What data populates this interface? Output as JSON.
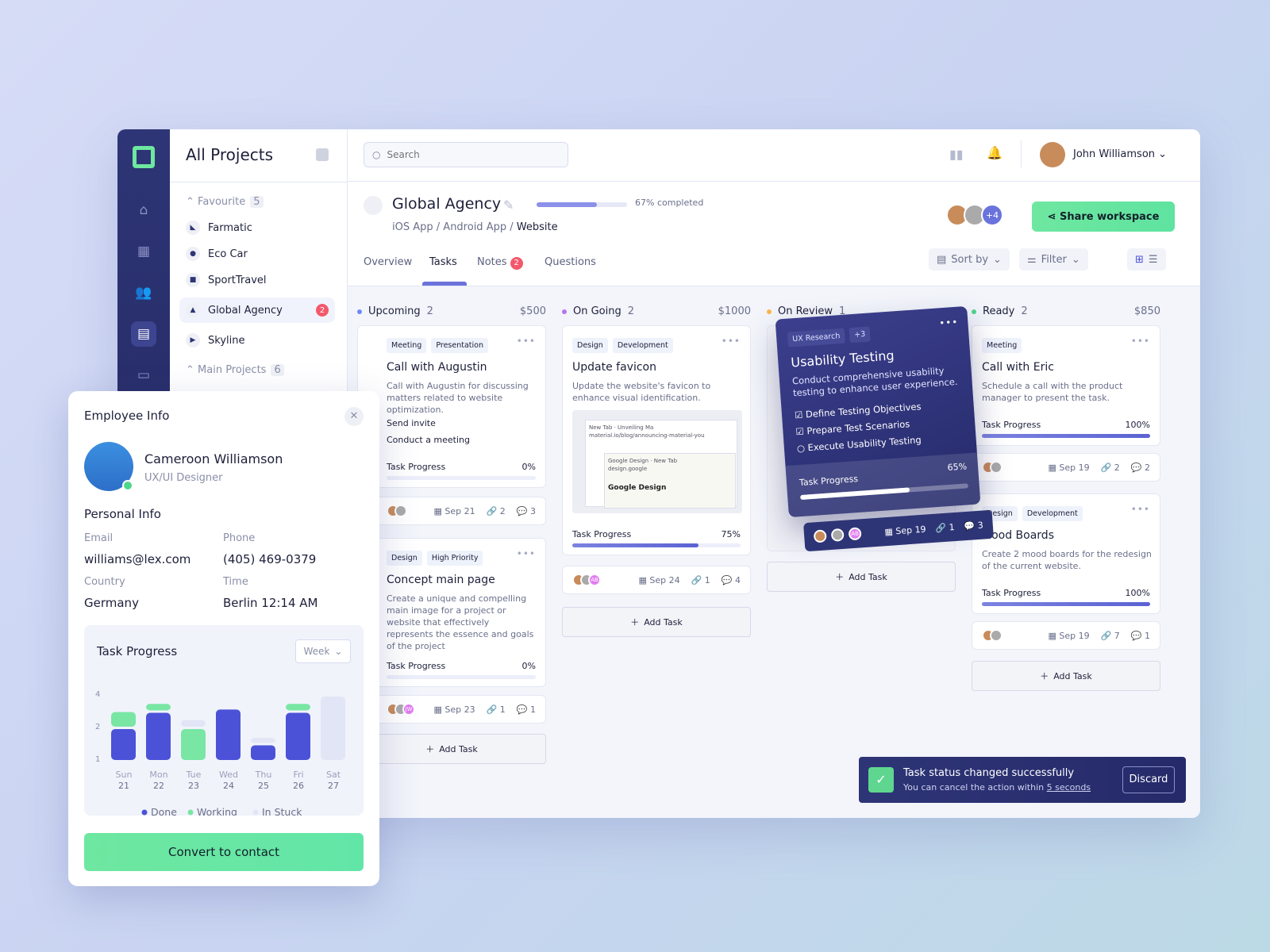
{
  "sidebar": {
    "title": "All Projects",
    "favourite_label": "Favourite",
    "favourite_count": "5",
    "projects": [
      {
        "name": "Farmatic"
      },
      {
        "name": "Eco Car"
      },
      {
        "name": "SportTravel"
      },
      {
        "name": "Global Agency",
        "badge": "2"
      },
      {
        "name": "Skyline"
      }
    ],
    "main_label": "Main Projects",
    "main_count": "6"
  },
  "topbar": {
    "search_placeholder": "Search",
    "user_name": "John Williamson"
  },
  "project": {
    "title": "Global Agency",
    "progress_percent": 67,
    "progress_text": "67% completed",
    "breadcrumb": [
      "iOS App",
      "Android App",
      "Website"
    ],
    "members_extra": "+4",
    "share_label": "Share workspace",
    "tabs": [
      {
        "label": "Overview"
      },
      {
        "label": "Tasks",
        "active": true
      },
      {
        "label": "Notes",
        "badge": "2"
      },
      {
        "label": "Questions"
      }
    ],
    "sort_label": "Sort by",
    "filter_label": "Filter"
  },
  "columns": [
    {
      "name": "Upcoming",
      "count": "2",
      "amount": "$500",
      "color": "#6b8bf5",
      "cards": [
        {
          "tags": [
            "Meeting",
            "Presentation"
          ],
          "title": "Call with Augustin",
          "desc": "Call with Augustin for discussing matters related to website optimization.",
          "checks": [
            "Send invite",
            "Conduct a meeting"
          ],
          "progress_label": "Task Progress",
          "progress": "0%",
          "date": "Sep 21",
          "links": "2",
          "comments": "3"
        },
        {
          "tags": [
            "Design",
            "High Priority"
          ],
          "title": "Concept main page",
          "desc": "Create a unique and compelling main image for a project or website that effectively represents the essence and goals of the project",
          "progress_label": "Task Progress",
          "progress": "0%",
          "date": "Sep 23",
          "links": "1",
          "comments": "1",
          "avatar_text": "JW"
        }
      ],
      "add_label": "Add Task"
    },
    {
      "name": "On Going",
      "count": "2",
      "amount": "$1000",
      "color": "#b476f0",
      "cards": [
        {
          "tags": [
            "Design",
            "Development"
          ],
          "title": "Update favicon",
          "desc": "Update  the website's favicon to enhance visual identification.",
          "preview": {
            "tab1": "New Tab",
            "tab2": "Unveiling Ma",
            "url": "material.io/blog/announcing-material-you",
            "tab3": "Google Design",
            "tab4": "New Tab",
            "url2": "design.google",
            "brand": "Google Design"
          },
          "progress_label": "Task Progress",
          "progress": "75%",
          "date": "Sep 24",
          "links": "1",
          "comments": "4",
          "avatar_text": "AB"
        }
      ],
      "add_label": "Add Task"
    },
    {
      "name": "On Review",
      "count": "1",
      "color": "#f7b84b",
      "cards": [
        {
          "tags": [
            "UX Research",
            "+3"
          ],
          "title": "Usability Testing",
          "desc": "Conduct comprehensive usability testing to enhance user experience.",
          "checks": [
            {
              "label": "Define Testing Objectives",
              "done": true
            },
            {
              "label": "Prepare Test Scenarios",
              "done": true
            },
            {
              "label": "Execute Usability Testing",
              "done": false
            }
          ],
          "progress_label": "Task Progress",
          "progress": "65%",
          "date": "Sep 19",
          "links": "1",
          "comments": "3",
          "avatar_text": "AB"
        }
      ],
      "add_label": "Add Task"
    },
    {
      "name": "Ready",
      "count": "2",
      "amount": "$850",
      "color": "#4fd68a",
      "cards": [
        {
          "tags": [
            "Meeting"
          ],
          "title": "Call with Eric",
          "desc": "Schedule a call with the product manager to present the task.",
          "progress_label": "Task Progress",
          "progress": "100%",
          "date": "Sep 19",
          "links": "2",
          "comments": "2"
        },
        {
          "tags": [
            "Design",
            "Development"
          ],
          "title": "Mood Boards",
          "desc": "Create 2 mood boards for the redesign of the current website.",
          "progress_label": "Task Progress",
          "progress": "100%",
          "date": "Sep 19",
          "links": "7",
          "comments": "1"
        }
      ],
      "add_label": "Add Task"
    }
  ],
  "employee": {
    "heading": "Employee Info",
    "name": "Cameroon Williamson",
    "role": "UX/UI Designer",
    "status_color": "#4fd68a",
    "personal_heading": "Personal Info",
    "email_label": "Email",
    "email": "williams@lex.com",
    "phone_label": "Phone",
    "phone": "(405) 469-0379",
    "country_label": "Country",
    "country": "Germany",
    "time_label": "Time",
    "time": "Berlin 12:14 AM",
    "convert_label": "Convert to contact"
  },
  "chart_data": {
    "type": "bar",
    "title": "Task Progress",
    "period": "Week",
    "yticks": [
      "4",
      "2",
      "1"
    ],
    "ylim": [
      0,
      4
    ],
    "categories": [
      "Sun",
      "Mon",
      "Tue",
      "Wed",
      "Thu",
      "Fri",
      "Sat"
    ],
    "dates": [
      "21",
      "22",
      "23",
      "24",
      "25",
      "26",
      "27"
    ],
    "series": [
      {
        "name": "Done",
        "color": "#4b52d8",
        "values": [
          2,
          3,
          0,
          3.2,
          1,
          3,
          0
        ]
      },
      {
        "name": "Working",
        "color": "#79e6a4",
        "values": [
          1,
          0.5,
          2,
          0,
          0,
          0.5,
          0
        ]
      },
      {
        "name": "In Stuck",
        "color": "#e2e5f5",
        "values": [
          0,
          0,
          0.5,
          0,
          0.4,
          0,
          4
        ]
      }
    ]
  },
  "toast": {
    "title": "Task status changed successfully",
    "message": "You can cancel the action within",
    "link": "5 seconds",
    "discard": "Discard"
  }
}
